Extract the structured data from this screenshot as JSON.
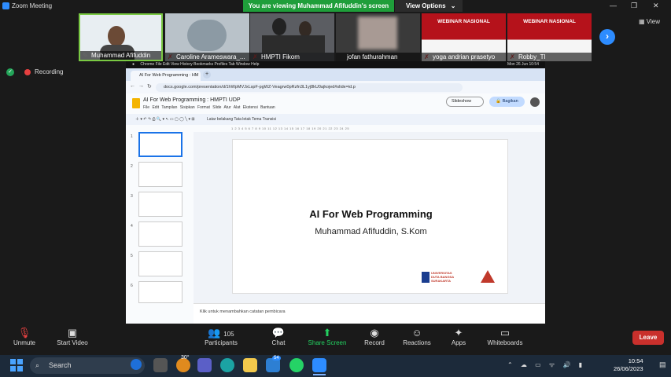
{
  "zoom": {
    "window_title": "Zoom Meeting",
    "banner": "You are viewing Muhammad Afifuddin's screen",
    "view_options": "View Options",
    "view_label": "View",
    "recording": "Recording"
  },
  "participants_strip": [
    {
      "name": "Muhammad Afifuddin"
    },
    {
      "name": "Caroline Arameswara_..."
    },
    {
      "name": "HMPTI Fikom"
    },
    {
      "name": "jofan fathurahman"
    },
    {
      "name": "yoga andrian prasetyo"
    },
    {
      "name": "Robby_TI"
    }
  ],
  "webinar_text": "WEBINAR NASIONAL",
  "browser": {
    "mac_menu": "Chrome   File   Edit   View   History   Bookmarks   Profiles   Tab   Window   Help",
    "mac_clock": "Mon 26 Jun  10:54",
    "tab_title": "AI For Web Programming : HM",
    "url": "docs.google.com/presentation/d/1hWpMVJxLspF-pgWZ-Veagrw0pRzfn3L1yj8kU0ajkojed#slide=id.p"
  },
  "slides_app": {
    "doc_title": "AI For Web Programming : HMPTI UDP",
    "menu": "File   Edit   Tampilan   Sisipkan   Format   Slide   Atur   Alat   Ekstensi   Bantuan",
    "slideshow_button": "Slideshow",
    "share_button": "Bagikan",
    "toolbar_items": "Latar belakang    Tata letak    Tema    Transisi",
    "ruler": "1   2   3   4   5   6   7   8   9   10   11   12   13   14   15   16   17   18   19   20   21   22   23   24   25",
    "slide_numbers": [
      "1",
      "2",
      "3",
      "4",
      "5",
      "6"
    ],
    "notes_placeholder": "Klik untuk menambahkan catatan pembicara"
  },
  "slide": {
    "title": "AI For Web Programming",
    "subtitle": "Muhammad Afifuddin, S.Kom",
    "logo_text_1": "UNIVERSITAS",
    "logo_text_2": "DUTA BANGSA",
    "logo_text_3": "SURAKARTA"
  },
  "controls": {
    "unmute": "Unmute",
    "start_video": "Start Video",
    "participants": "Participants",
    "participants_count": "105",
    "chat": "Chat",
    "share_screen": "Share Screen",
    "record": "Record",
    "reactions": "Reactions",
    "apps": "Apps",
    "whiteboards": "Whiteboards",
    "leave": "Leave"
  },
  "taskbar": {
    "search": "Search",
    "weather": "30°",
    "badge": "54",
    "time": "10:54",
    "date": "26/06/2023"
  },
  "colors": {
    "zoom_blue": "#2d8cff",
    "banner_green": "#1f9e3a",
    "leave_red": "#c9302c",
    "share_green": "#23d160"
  }
}
